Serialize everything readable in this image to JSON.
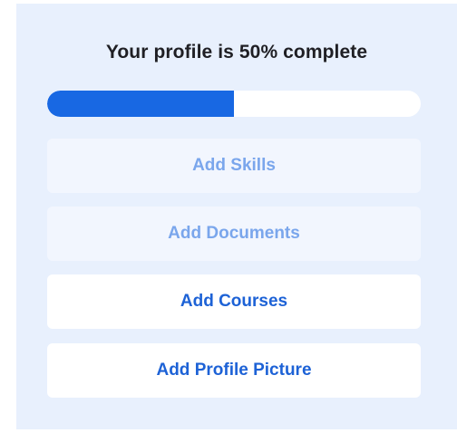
{
  "profile": {
    "title": "Your profile is 50% complete",
    "progress_percent": 50,
    "accent_color": "#1868e3",
    "tasks": [
      {
        "label": "Add Skills",
        "state": "completed"
      },
      {
        "label": "Add Documents",
        "state": "completed"
      },
      {
        "label": "Add Courses",
        "state": "pending"
      },
      {
        "label": "Add Profile Picture",
        "state": "pending"
      }
    ]
  }
}
